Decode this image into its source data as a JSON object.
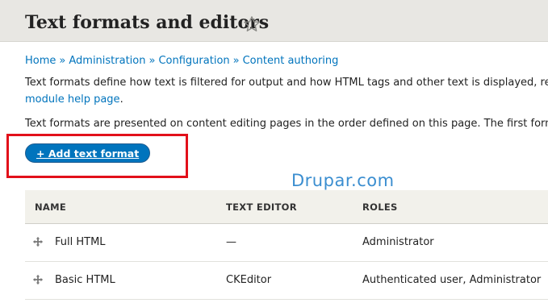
{
  "page": {
    "title": "Text formats and editors",
    "star_icon": "star-outline-icon"
  },
  "breadcrumb": {
    "items": [
      "Home",
      "Administration",
      "Configuration",
      "Content authoring"
    ],
    "separator": "»"
  },
  "intro": {
    "line1": "Text formats define how text is filtered for output and how HTML tags and other text is displayed, repl",
    "link": "module help page",
    "link_suffix": ".",
    "line2": "Text formats are presented on content editing pages in the order defined on this page. The first forma"
  },
  "add_button": {
    "label": "+ Add text format"
  },
  "watermark": {
    "text": "Drupar.com"
  },
  "table": {
    "headers": {
      "name": "NAME",
      "editor": "TEXT EDITOR",
      "roles": "ROLES"
    },
    "rows": [
      {
        "name": "Full HTML",
        "editor": "—",
        "roles": "Administrator"
      },
      {
        "name": "Basic HTML",
        "editor": "CKEditor",
        "roles": "Authenticated user, Administrator"
      }
    ],
    "drag_icon": "drag-handle-icon"
  },
  "colors": {
    "link": "#0074bd",
    "button": "#0074bd",
    "highlight": "#e2101a",
    "header_bg": "#e8e7e3",
    "watermark": "#3b8ed0"
  }
}
